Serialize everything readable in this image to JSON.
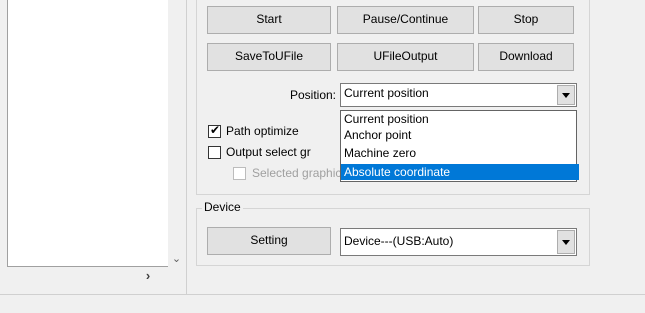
{
  "buttons": {
    "start": "Start",
    "pause_continue": "Pause/Continue",
    "stop": "Stop",
    "save_to_ufile": "SaveToUFile",
    "ufile_output": "UFileOutput",
    "download": "Download"
  },
  "position": {
    "label": "Position:",
    "selected": "Current position",
    "options": [
      "Current position",
      "Anchor point",
      "Machine zero",
      "Absolute coordinate"
    ],
    "highlighted": "Absolute coordinate"
  },
  "options": {
    "path_optimize": {
      "label": "Path optimize",
      "checked": true
    },
    "output_select": {
      "label": "Output select gr",
      "checked": false
    },
    "selected_graphics": {
      "label": "Selected graphics position",
      "checked": false,
      "disabled": true
    }
  },
  "device": {
    "group_label": "Device",
    "setting_button": "Setting",
    "selected": "Device---(USB:Auto)"
  },
  "icons": {
    "scroll_down": "chevron-down-icon",
    "scroll_right": "chevron-right-icon",
    "dropdown": "triangle-down-icon"
  },
  "colors": {
    "highlight": "#0078d7",
    "window": "#f0f0f0"
  }
}
